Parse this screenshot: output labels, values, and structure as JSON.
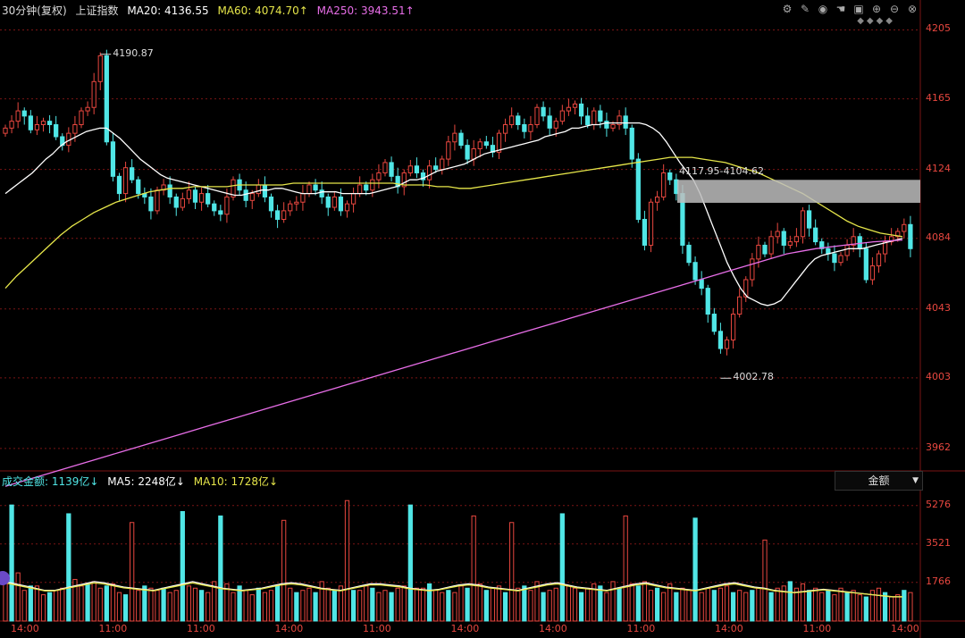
{
  "header": {
    "period": "30分钟(复权)",
    "index_name": "上证指数",
    "ma20_label": "MA20: 4136.55",
    "ma60_label": "MA60: 4074.70↑",
    "ma250_label": "MA250: 3943.51↑"
  },
  "volume_header": {
    "title": "成交金额: 1139亿↓",
    "ma5_label": "MA5: 2248亿↓",
    "ma10_label": "MA10: 1728亿↓",
    "selector": "金额"
  },
  "toolbar_icons": [
    "settings-icon",
    "edit-icon",
    "eye-icon",
    "hand-icon",
    "camera-icon",
    "zoom-in-icon",
    "zoom-out-icon",
    "close-icon"
  ],
  "colors": {
    "up": "#e8473f",
    "down": "#50e6e6",
    "ma20": "#ffffff",
    "ma60": "#e6e64a",
    "ma250": "#e86ee8",
    "grid": "#7a1515"
  },
  "chart_data": [
    {
      "type": "candlestick",
      "y_ticks": [
        4205,
        4165,
        4124,
        4084,
        4043,
        4003,
        3962
      ],
      "ylim": [
        3950,
        4212
      ],
      "x_tick_labels": [
        "14:00",
        "11:00",
        "11:00",
        "14:00",
        "11:00",
        "14:00",
        "14:00",
        "11:00",
        "14:00",
        "11:00",
        "14:00"
      ],
      "annotations": {
        "high": "4190.87",
        "low": "4002.78",
        "gap": "4117.95-4104.62"
      },
      "gap_zone": [
        4104.62,
        4117.95
      ],
      "close": [
        4148,
        4152,
        4158,
        4155,
        4147,
        4150,
        4152,
        4150,
        4143,
        4138,
        4145,
        4150,
        4158,
        4160,
        4175,
        4190,
        4140,
        4120,
        4110,
        4125,
        4118,
        4110,
        4108,
        4100,
        4112,
        4115,
        4108,
        4102,
        4107,
        4112,
        4105,
        4110,
        4104,
        4100,
        4098,
        4108,
        4118,
        4112,
        4106,
        4110,
        4115,
        4108,
        4100,
        4095,
        4100,
        4104,
        4105,
        4110,
        4115,
        4112,
        4108,
        4102,
        4108,
        4100,
        4104,
        4110,
        4115,
        4112,
        4118,
        4122,
        4128,
        4120,
        4114,
        4122,
        4126,
        4122,
        4118,
        4126,
        4124,
        4130,
        4140,
        4145,
        4138,
        4130,
        4136,
        4140,
        4138,
        4134,
        4145,
        4150,
        4155,
        4150,
        4146,
        4150,
        4160,
        4155,
        4148,
        4152,
        4158,
        4160,
        4162,
        4155,
        4150,
        4158,
        4152,
        4148,
        4150,
        4155,
        4148,
        4130,
        4095,
        4080,
        4105,
        4108,
        4122,
        4118,
        4110,
        4080,
        4070,
        4060,
        4055,
        4040,
        4030,
        4020,
        4025,
        4040,
        4050,
        4060,
        4072,
        4080,
        4075,
        4085,
        4088,
        4080,
        4082,
        4085,
        4100,
        4090,
        4082,
        4078,
        4075,
        4070,
        4074,
        4080,
        4085,
        4078,
        4060,
        4068,
        4075,
        4082,
        4085,
        4088,
        4092,
        4078
      ],
      "ma20": [
        4110,
        4113,
        4116,
        4119,
        4122,
        4126,
        4130,
        4133,
        4137,
        4140,
        4142,
        4144,
        4146,
        4147,
        4148,
        4148,
        4145,
        4142,
        4138,
        4134,
        4130,
        4127,
        4124,
        4121,
        4119,
        4118,
        4117,
        4116,
        4115,
        4114,
        4113,
        4112,
        4111,
        4110,
        4109,
        4109,
        4110,
        4111,
        4112,
        4112,
        4113,
        4113,
        4112,
        4111,
        4110,
        4110,
        4110,
        4111,
        4111,
        4111,
        4110,
        4110,
        4110,
        4110,
        4110,
        4111,
        4112,
        4113,
        4114,
        4116,
        4118,
        4118,
        4119,
        4121,
        4123,
        4124,
        4125,
        4126,
        4127,
        4129,
        4131,
        4133,
        4134,
        4135,
        4136,
        4137,
        4138,
        4139,
        4140,
        4141,
        4143,
        4144,
        4145,
        4146,
        4148,
        4148,
        4149,
        4150,
        4150,
        4151,
        4151,
        4151,
        4151,
        4151,
        4151,
        4150,
        4148,
        4145,
        4140,
        4134,
        4128,
        4123,
        4118,
        4110,
        4100,
        4090,
        4080,
        4070,
        4062,
        4055,
        4050,
        4048,
        4046,
        4045,
        4046,
        4048,
        4053,
        4058,
        4063,
        4068,
        4072,
        4074,
        4075,
        4076,
        4077,
        4078,
        4078,
        4078,
        4079,
        4080,
        4081,
        4082,
        4083,
        4084
      ],
      "ma60": [
        4055,
        4062,
        4068,
        4074,
        4080,
        4086,
        4091,
        4095,
        4099,
        4102,
        4105,
        4107,
        4109,
        4111,
        4112,
        4113,
        4113,
        4114,
        4114,
        4114,
        4114,
        4115,
        4115,
        4115,
        4115,
        4115,
        4116,
        4116,
        4116,
        4116,
        4116,
        4116,
        4116,
        4116,
        4116,
        4116,
        4115,
        4115,
        4115,
        4114,
        4114,
        4113,
        4113,
        4114,
        4115,
        4116,
        4117,
        4118,
        4119,
        4120,
        4121,
        4122,
        4123,
        4124,
        4125,
        4126,
        4127,
        4128,
        4129,
        4130,
        4131,
        4131,
        4131,
        4130,
        4129,
        4128,
        4126,
        4124,
        4122,
        4119,
        4116,
        4113,
        4110,
        4106,
        4102,
        4098,
        4094,
        4091,
        4089,
        4087,
        4086,
        4085
      ],
      "ma250": [
        3940,
        3945,
        3950,
        3955,
        3960,
        3965,
        3970,
        3975,
        3980,
        3985,
        3990,
        3995,
        4000,
        4005,
        4010,
        4015,
        4020,
        4025,
        4030,
        4035,
        4040,
        4045,
        4050,
        4055,
        4060,
        4065,
        4070,
        4075,
        4078,
        4080,
        4082,
        4083
      ]
    },
    {
      "type": "bar",
      "y_ticks": [
        5276,
        3521,
        1766
      ],
      "ylim": [
        0,
        6000
      ],
      "values": [
        1900,
        5300,
        2200,
        1400,
        1600,
        1600,
        1200,
        1300,
        1400,
        1500,
        4900,
        1900,
        1600,
        1700,
        1800,
        1500,
        1600,
        1700,
        1300,
        1200,
        4500,
        1400,
        1600,
        1500,
        1400,
        1500,
        1300,
        1400,
        5000,
        1600,
        1500,
        1400,
        1300,
        1800,
        4800,
        1700,
        1300,
        1600,
        1400,
        1200,
        1500,
        1300,
        1400,
        1600,
        4600,
        1500,
        1300,
        1400,
        1500,
        1300,
        1800,
        1500,
        1400,
        1600,
        5500,
        1400,
        1400,
        1600,
        1500,
        1300,
        1400,
        1300,
        1500,
        1600,
        5300,
        1500,
        1500,
        1700,
        1400,
        1300,
        1400,
        1300,
        1600,
        1500,
        4800,
        1700,
        1400,
        1500,
        1600,
        1300,
        4500,
        1500,
        1600,
        1400,
        1800,
        1300,
        1400,
        1500,
        4900,
        1600,
        1500,
        1300,
        1500,
        1700,
        1600,
        1300,
        1800,
        1500,
        4800,
        1700,
        1600,
        1800,
        1400,
        1500,
        1300,
        1700,
        1300,
        1500,
        1400,
        4700,
        1300,
        1500,
        1400,
        1500,
        1600,
        1300,
        1400,
        1300,
        1400,
        1500,
        3700,
        1300,
        1500,
        1600,
        1800,
        1500,
        1700,
        1400,
        1500,
        1300,
        1400,
        1200,
        1500,
        1300,
        1400,
        1200,
        1100,
        1400,
        1500,
        1300,
        1100,
        1200,
        1400,
        1300
      ],
      "ma5": [
        1800,
        1700,
        1600,
        1500,
        1400,
        1400,
        1500,
        1600,
        1700,
        1800,
        1750,
        1650,
        1550,
        1500,
        1450,
        1400,
        1500,
        1600,
        1700,
        1800,
        1700,
        1600,
        1500,
        1450,
        1400,
        1450,
        1500,
        1600,
        1700,
        1750,
        1700,
        1600,
        1500,
        1450,
        1400,
        1500,
        1600,
        1700,
        1700,
        1650,
        1600,
        1500,
        1450,
        1400,
        1450,
        1550,
        1650,
        1700,
        1650,
        1550,
        1500,
        1450,
        1400,
        1500,
        1600,
        1700,
        1750,
        1650,
        1550,
        1500,
        1450,
        1400,
        1500,
        1600,
        1700,
        1750,
        1650,
        1550,
        1500,
        1450,
        1400,
        1500,
        1600,
        1700,
        1750,
        1650,
        1550,
        1500,
        1400,
        1350,
        1300,
        1350,
        1400,
        1450,
        1400,
        1350,
        1300,
        1250,
        1200,
        1150,
        1100,
        1100
      ]
    }
  ]
}
